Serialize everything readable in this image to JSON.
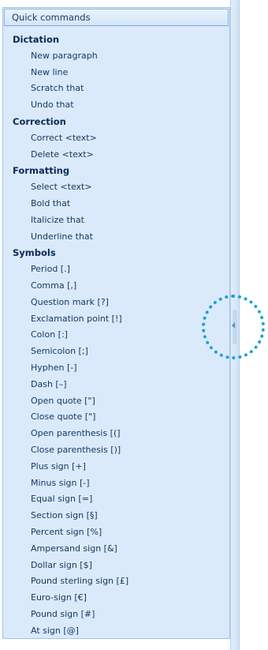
{
  "panel": {
    "title": "Quick commands"
  },
  "categories": [
    {
      "name": "Dictation",
      "items": [
        "New paragraph",
        "New line",
        "Scratch that",
        "Undo that"
      ]
    },
    {
      "name": "Correction",
      "items": [
        "Correct <text>",
        "Delete <text>"
      ]
    },
    {
      "name": "Formatting",
      "items": [
        "Select <text>",
        "Bold that",
        "Italicize that",
        "Underline that"
      ]
    },
    {
      "name": "Symbols",
      "items": [
        "Period [.]",
        "Comma [,]",
        "Question mark [?]",
        "Exclamation point [!]",
        "Colon [:]",
        "Semicolon [;]",
        "Hyphen [-]",
        "Dash [–]",
        "Open quote [\"]",
        "Close quote [\"]",
        "Open parenthesis [(]",
        "Close parenthesis [)]",
        "Plus sign [+]",
        "Minus sign [-]",
        "Equal sign [=]",
        "Section sign [§]",
        "Percent sign [%]",
        "Ampersand sign [&]",
        "Dollar sign [$]",
        "Pound sterling sign [£]",
        "Euro-sign [€]",
        "Pound sign [#]",
        "At sign [@]"
      ]
    }
  ],
  "splitter": {
    "collapse_icon": "chevron-left-icon"
  },
  "colors": {
    "panel_background": "#daeafb",
    "panel_border": "#9fc4e8",
    "header_text": "#1d3a63",
    "category_text": "#0a2a55",
    "item_text": "#14365f",
    "highlight_ring": "#1aa0d2"
  }
}
